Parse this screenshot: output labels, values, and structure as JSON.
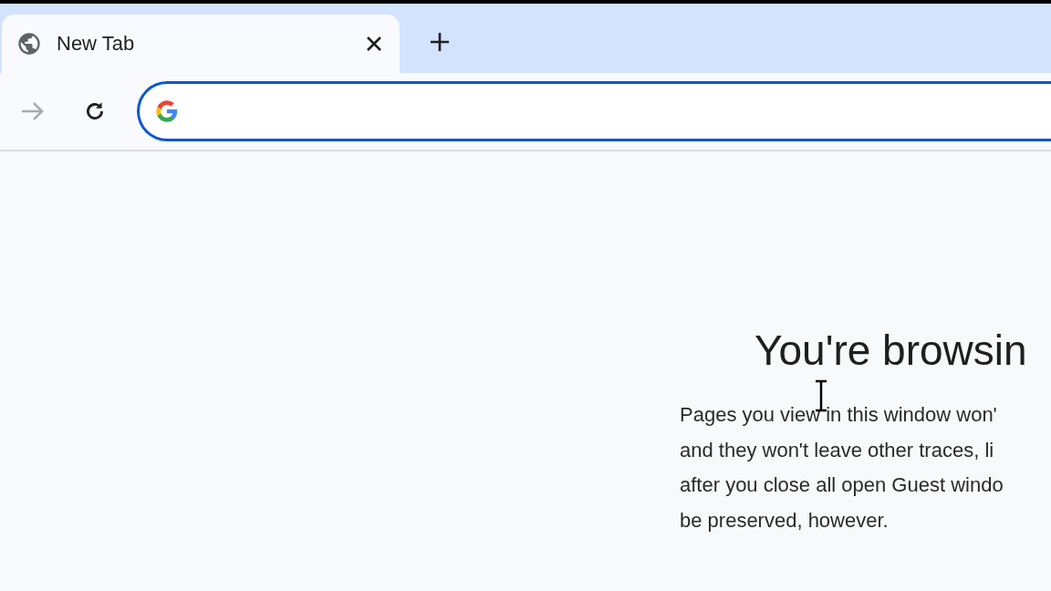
{
  "tabs": [
    {
      "title": "New Tab",
      "selected": true
    }
  ],
  "toolbar": {
    "forward_disabled": true,
    "address_focused": true
  },
  "page": {
    "heading": "You're browsin",
    "lines": [
      "Pages you view in this window won'",
      "and they won't leave other traces, li",
      "after you close all open Guest windo",
      "be preserved, however."
    ]
  }
}
